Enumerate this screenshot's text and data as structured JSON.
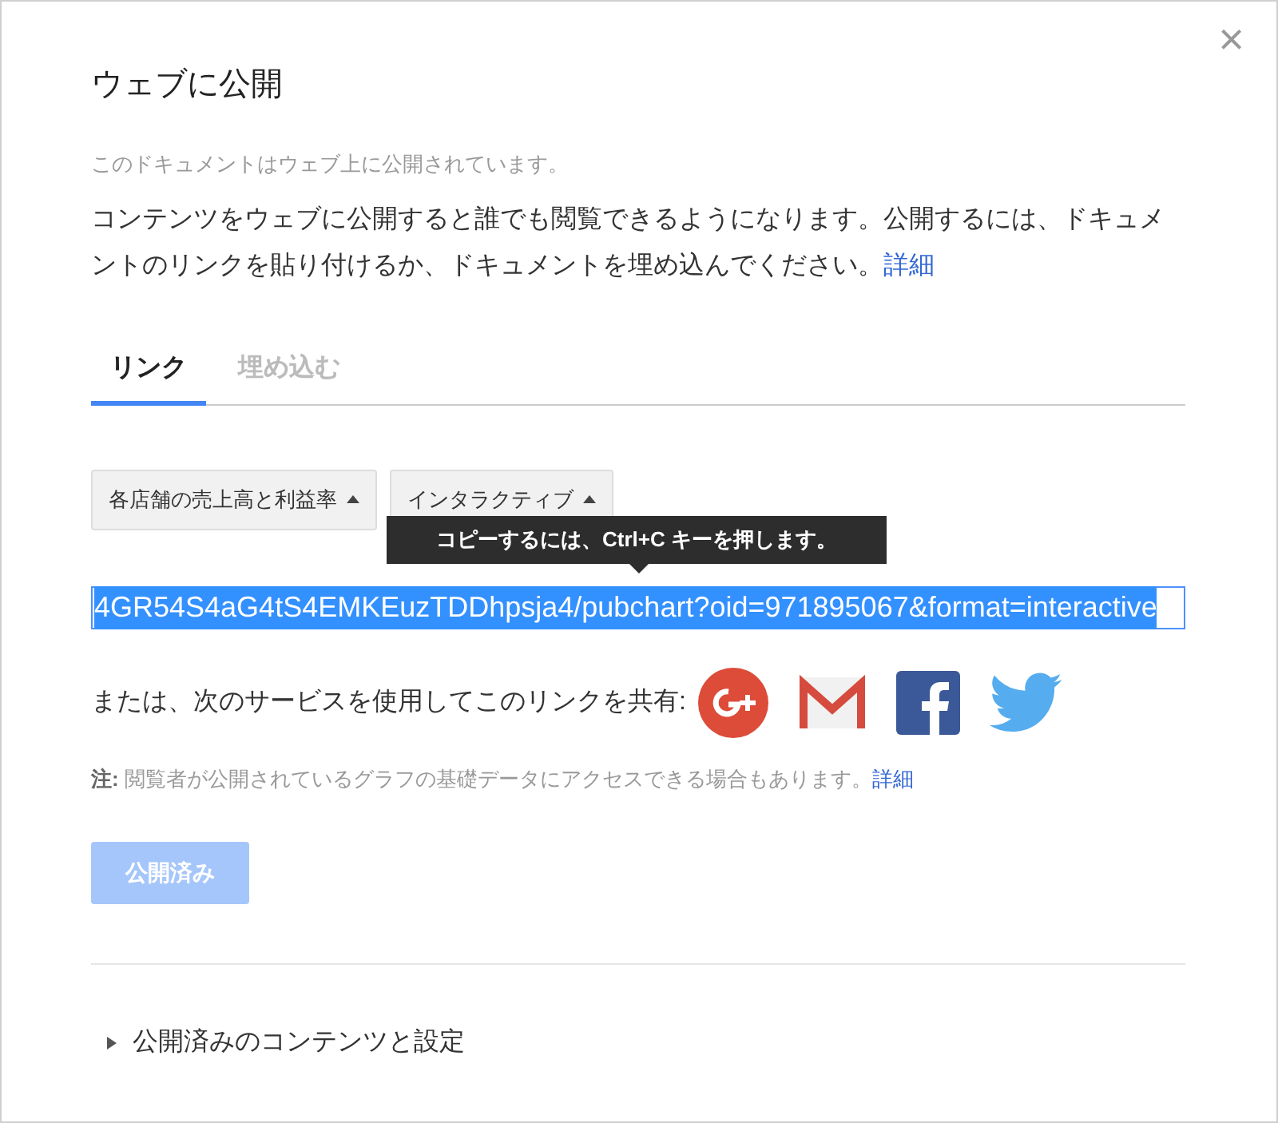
{
  "dialog": {
    "title": "ウェブに公開",
    "close": "×"
  },
  "status": "このドキュメントはウェブ上に公開されています。",
  "description": {
    "text": "コンテンツをウェブに公開すると誰でも閲覧できるようになります。公開するには、ドキュメントのリンクを貼り付けるか、ドキュメントを埋め込んでください。",
    "link": "詳細"
  },
  "tabs": [
    {
      "label": "リンク",
      "selected": true
    },
    {
      "label": "埋め込む",
      "selected": false
    }
  ],
  "dropdowns": [
    {
      "value": "各店舗の売上高と利益率"
    },
    {
      "value": "インタラクティブ"
    }
  ],
  "tooltip": "コピーするには、Ctrl+C キーを押します。",
  "link_field": {
    "value": "4GR54S4aG4tS4EMKEuzTDDhpsja4/pubchart?oid=971895067&format=interactive",
    "selected": true
  },
  "share": {
    "label": "または、次のサービスを使用してこのリンクを共有:",
    "services": [
      {
        "kind": "gplus"
      },
      {
        "kind": "gmail"
      },
      {
        "kind": "facebook"
      },
      {
        "kind": "twitter"
      }
    ]
  },
  "note": {
    "label": "注:",
    "text": "閲覧者が公開されているグラフの基礎データにアクセスできる場合もあります。",
    "link": "詳細"
  },
  "publish_button": {
    "label": "公開済み",
    "disabled": true
  },
  "section": {
    "label": "公開済みのコンテンツと設定",
    "expanded": false
  }
}
